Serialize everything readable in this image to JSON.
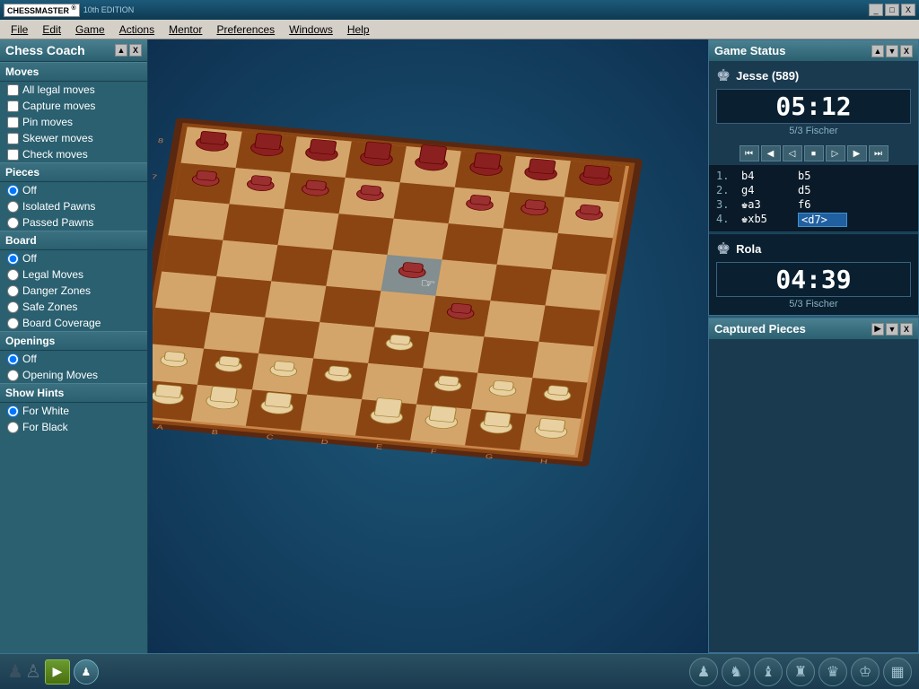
{
  "titlebar": {
    "logo": "CHESSMASTER",
    "subtitle": "10th EDITION",
    "controls": [
      "_",
      "□",
      "X"
    ]
  },
  "menubar": {
    "items": [
      "File",
      "Edit",
      "Game",
      "Actions",
      "Mentor",
      "Preferences",
      "Windows",
      "Help"
    ]
  },
  "chess_coach": {
    "title": "Chess Coach",
    "controls": [
      "▲",
      "X"
    ],
    "sections": {
      "moves": {
        "label": "Moves",
        "options": [
          {
            "label": "All legal moves",
            "type": "checkbox",
            "checked": false
          },
          {
            "label": "Capture moves",
            "type": "checkbox",
            "checked": false
          },
          {
            "label": "Pin moves",
            "type": "checkbox",
            "checked": false
          },
          {
            "label": "Skewer moves",
            "type": "checkbox",
            "checked": false
          },
          {
            "label": "Check moves",
            "type": "checkbox",
            "checked": false
          }
        ]
      },
      "pieces": {
        "label": "Pieces",
        "options": [
          {
            "label": "Off",
            "type": "radio",
            "name": "pieces",
            "checked": true
          },
          {
            "label": "Isolated Pawns",
            "type": "radio",
            "name": "pieces",
            "checked": false
          },
          {
            "label": "Passed Pawns",
            "type": "radio",
            "name": "pieces",
            "checked": false
          }
        ]
      },
      "board": {
        "label": "Board",
        "options": [
          {
            "label": "Off",
            "type": "radio",
            "name": "board",
            "checked": true
          },
          {
            "label": "Legal Moves",
            "type": "radio",
            "name": "board",
            "checked": false
          },
          {
            "label": "Danger Zones",
            "type": "radio",
            "name": "board",
            "checked": false
          },
          {
            "label": "Safe Zones",
            "type": "radio",
            "name": "board",
            "checked": false
          },
          {
            "label": "Board Coverage",
            "type": "radio",
            "name": "board",
            "checked": false
          }
        ]
      },
      "openings": {
        "label": "Openings",
        "options": [
          {
            "label": "Off",
            "type": "radio",
            "name": "openings",
            "checked": true
          },
          {
            "label": "Opening Moves",
            "type": "radio",
            "name": "openings",
            "checked": false
          }
        ]
      },
      "show_hints": {
        "label": "Show Hints",
        "options": [
          {
            "label": "For White",
            "type": "radio",
            "name": "hints",
            "checked": true
          },
          {
            "label": "For Black",
            "type": "radio",
            "name": "hints",
            "checked": false
          }
        ]
      }
    }
  },
  "game_status": {
    "title": "Game Status",
    "controls": [
      "▲",
      "▼",
      "X"
    ],
    "player1": {
      "name": "Jesse (589)",
      "timer": "05:12",
      "rating": "5/3 Fischer"
    },
    "player2": {
      "name": "Rola",
      "timer": "04:39",
      "rating": "5/3 Fischer"
    },
    "controls_bar": [
      "⏮",
      "◀",
      "◁",
      "⏹",
      "▷",
      "▶",
      "⏭"
    ],
    "moves": [
      {
        "num": "1.",
        "white": "b4",
        "black": "b5"
      },
      {
        "num": "2.",
        "white": "g4",
        "black": "d5"
      },
      {
        "num": "3.",
        "white": "♚a3",
        "black": "f6"
      },
      {
        "num": "4.",
        "white": "♚xb5",
        "black": "<d7>"
      }
    ]
  },
  "captured_pieces": {
    "title": "Captured Pieces",
    "controls": [
      "▶",
      "▼",
      "X"
    ]
  },
  "bottom_toolbar": {
    "pawn_black": "♟",
    "pawn_white": "♙",
    "play_btn": "▶",
    "hint_btn": "♟",
    "tools": [
      "♟",
      "♞",
      "♝",
      "♜",
      "♛",
      "♔",
      "▦"
    ]
  }
}
